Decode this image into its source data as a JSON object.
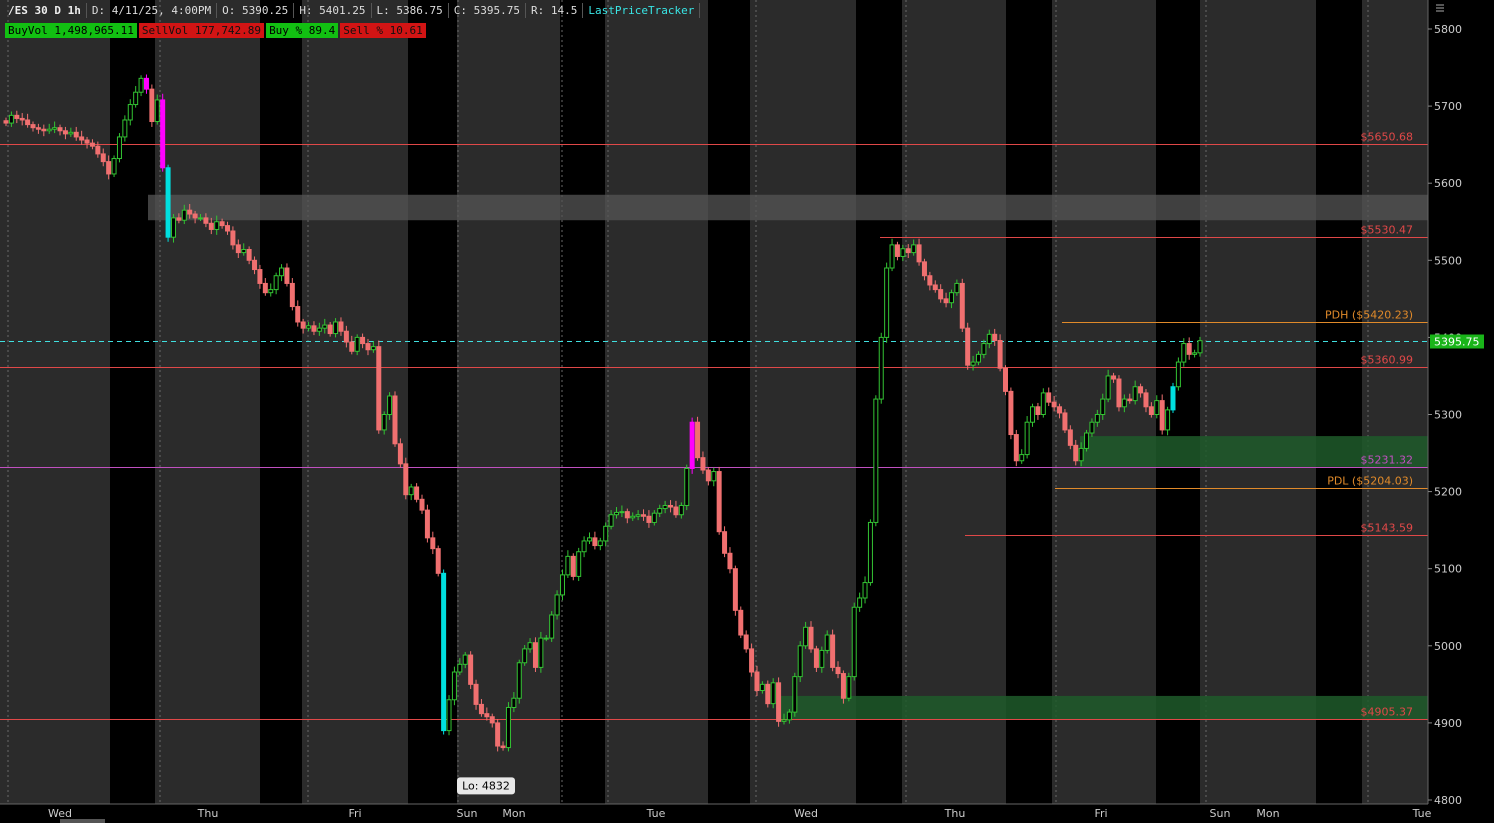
{
  "header": {
    "symbol": "/ES 30 D 1h",
    "date": "D: 4/11/25, 4:00PM",
    "open": "O: 5390.25",
    "high": "H: 5401.25",
    "low": "L: 5386.75",
    "close": "C: 5395.75",
    "range": "R: 14.5",
    "study": "LastPriceTracker"
  },
  "pills": {
    "buy_vol": "BuyVol 1,498,965.11",
    "sell_vol": "SellVol 177,742.89",
    "buy_pct": "Buy % 89.4",
    "sell_pct": "Sell % 10.61"
  },
  "colors": {
    "background": "#000000",
    "session_shade": "#2b2b2b",
    "up_candle": "#33c433",
    "down_candle": "#f07070",
    "level_red": "#e04848",
    "level_magenta": "#c050c0",
    "level_orange": "#e08a2a",
    "last_price": "#40e0e0",
    "zone_gray": "#555555",
    "zone_green": "#1e5a2a"
  },
  "chart_data": {
    "type": "candlestick",
    "title": "/ES 30 D 1h",
    "ylim": [
      4800,
      5800
    ],
    "y_ticks": [
      4800,
      4900,
      5000,
      5100,
      5200,
      5300,
      5400,
      5500,
      5600,
      5700,
      5800
    ],
    "x_tick_labels": [
      "Wed",
      "Thu",
      "Fri",
      "Sun",
      "Mon",
      "Tue",
      "Wed",
      "Thu",
      "Fri",
      "Sun",
      "Mon",
      "Tue"
    ],
    "levels": [
      {
        "label": "$5650.68",
        "value": 5650.68,
        "color": "red"
      },
      {
        "label": "$5530.47",
        "value": 5530.47,
        "color": "red"
      },
      {
        "label": "PDH ($5420.23)",
        "value": 5420.23,
        "color": "orange"
      },
      {
        "label": "$5360.99",
        "value": 5360.99,
        "color": "red"
      },
      {
        "label": "$5231.32",
        "value": 5231.32,
        "color": "magenta"
      },
      {
        "label": "PDL ($5204.03)",
        "value": 5204.03,
        "color": "orange"
      },
      {
        "label": "$5143.59",
        "value": 5143.59,
        "color": "red"
      },
      {
        "label": "$4905.37",
        "value": 4905.37,
        "color": "red"
      }
    ],
    "zones": [
      {
        "kind": "gray",
        "low": 5552,
        "high": 5585
      },
      {
        "kind": "green",
        "low": 5232,
        "high": 5272
      },
      {
        "kind": "green",
        "low": 4905,
        "high": 4935
      }
    ],
    "last_price": {
      "label": "5395.75",
      "value": 5395.75
    },
    "low_callout": {
      "label": "Lo: 4832",
      "value": 4832
    },
    "closes": [
      5678,
      5688,
      5684,
      5682,
      5676,
      5672,
      5670,
      5668,
      5670,
      5672,
      5668,
      5664,
      5666,
      5660,
      5656,
      5652,
      5648,
      5638,
      5628,
      5612,
      5632,
      5660,
      5682,
      5702,
      5718,
      5736,
      5722,
      5680,
      5708,
      5620,
      5530,
      5555,
      5552,
      5565,
      5560,
      5555,
      5555,
      5548,
      5540,
      5550,
      5545,
      5538,
      5520,
      5510,
      5514,
      5500,
      5488,
      5470,
      5458,
      5462,
      5480,
      5490,
      5470,
      5440,
      5420,
      5412,
      5415,
      5408,
      5412,
      5416,
      5405,
      5420,
      5408,
      5394,
      5382,
      5400,
      5392,
      5384,
      5388,
      5280,
      5300,
      5324,
      5262,
      5236,
      5196,
      5206,
      5190,
      5176,
      5140,
      5126,
      5094,
      4890,
      4930,
      4966,
      4976,
      4988,
      4950,
      4924,
      4912,
      4908,
      4900,
      4870,
      4868,
      4920,
      4932,
      4978,
      4996,
      5004,
      4972,
      5010,
      5010,
      5040,
      5066,
      5092,
      5116,
      5090,
      5122,
      5136,
      5140,
      5130,
      5136,
      5155,
      5170,
      5173,
      5174,
      5166,
      5168,
      5170,
      5168,
      5160,
      5172,
      5178,
      5182,
      5180,
      5170,
      5182,
      5230,
      5290,
      5244,
      5228,
      5214,
      5226,
      5148,
      5120,
      5100,
      5046,
      5014,
      4996,
      4966,
      4942,
      4950,
      4925,
      4952,
      4902,
      4904,
      4914,
      4960,
      5000,
      5024,
      4996,
      4972,
      4994,
      5014,
      4972,
      4964,
      4932,
      4960,
      5050,
      5062,
      5082,
      5160,
      5320,
      5400,
      5490,
      5520,
      5505,
      5515,
      5510,
      5520,
      5498,
      5480,
      5468,
      5462,
      5450,
      5445,
      5458,
      5470,
      5412,
      5364,
      5368,
      5378,
      5392,
      5404,
      5396,
      5360,
      5330,
      5274,
      5240,
      5248,
      5290,
      5310,
      5300,
      5328,
      5316,
      5310,
      5302,
      5280,
      5260,
      5240,
      5256,
      5276,
      5290,
      5300,
      5320,
      5350,
      5346,
      5310,
      5320,
      5318,
      5336,
      5328,
      5310,
      5300,
      5318,
      5280,
      5306,
      5336,
      5368,
      5392,
      5378,
      5380,
      5395.75
    ]
  }
}
